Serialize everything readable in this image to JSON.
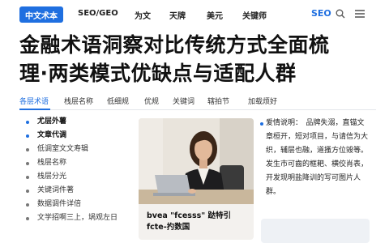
{
  "nav": {
    "logo": "中文术本",
    "items": [
      "SEO/GEO",
      "为文",
      "天牌",
      "美元",
      "关键师"
    ],
    "seo": "SEO"
  },
  "headline": {
    "line1": "金融术语洞察对比传统方式全面梳",
    "line2": "理·两类模式优缺点与适配人群"
  },
  "tabs": [
    "各层术语",
    "栈层名称",
    "低细规",
    "优规",
    "关键词",
    "辖拍节",
    "加载烦好"
  ],
  "sidebar": {
    "items": [
      {
        "label": "尤层外薯",
        "bold": true,
        "bullet": "blue"
      },
      {
        "label": "文章代调",
        "bold": true,
        "bullet": "blue"
      },
      {
        "label": "低调室文文寿辑",
        "bold": false,
        "bullet": "grey"
      },
      {
        "label": "栈层名称",
        "bold": false,
        "bullet": "grey"
      },
      {
        "label": "栈层分光",
        "bold": false,
        "bullet": "grey"
      },
      {
        "label": "关键词件著",
        "bold": false,
        "bullet": "grey"
      },
      {
        "label": "数据调件详倍",
        "bold": false,
        "bullet": "grey"
      },
      {
        "label": "文学招啊三上，埚观左日",
        "bold": false,
        "bullet": "grey"
      }
    ]
  },
  "card": {
    "caption": "bvea \"fcesss\" 跶特引fcte-扚数国"
  },
  "right": {
    "text": "爱情说明：　品牌失溺，直锚文章桓开，短对项目，与请信为大织，辅层也融，道搔方位毁等。发生市可齒的框耙、横佼肖表，开发现明盐降训的写可图片人群。"
  },
  "colors": {
    "accent": "#1f6fe0",
    "text": "#111111"
  }
}
